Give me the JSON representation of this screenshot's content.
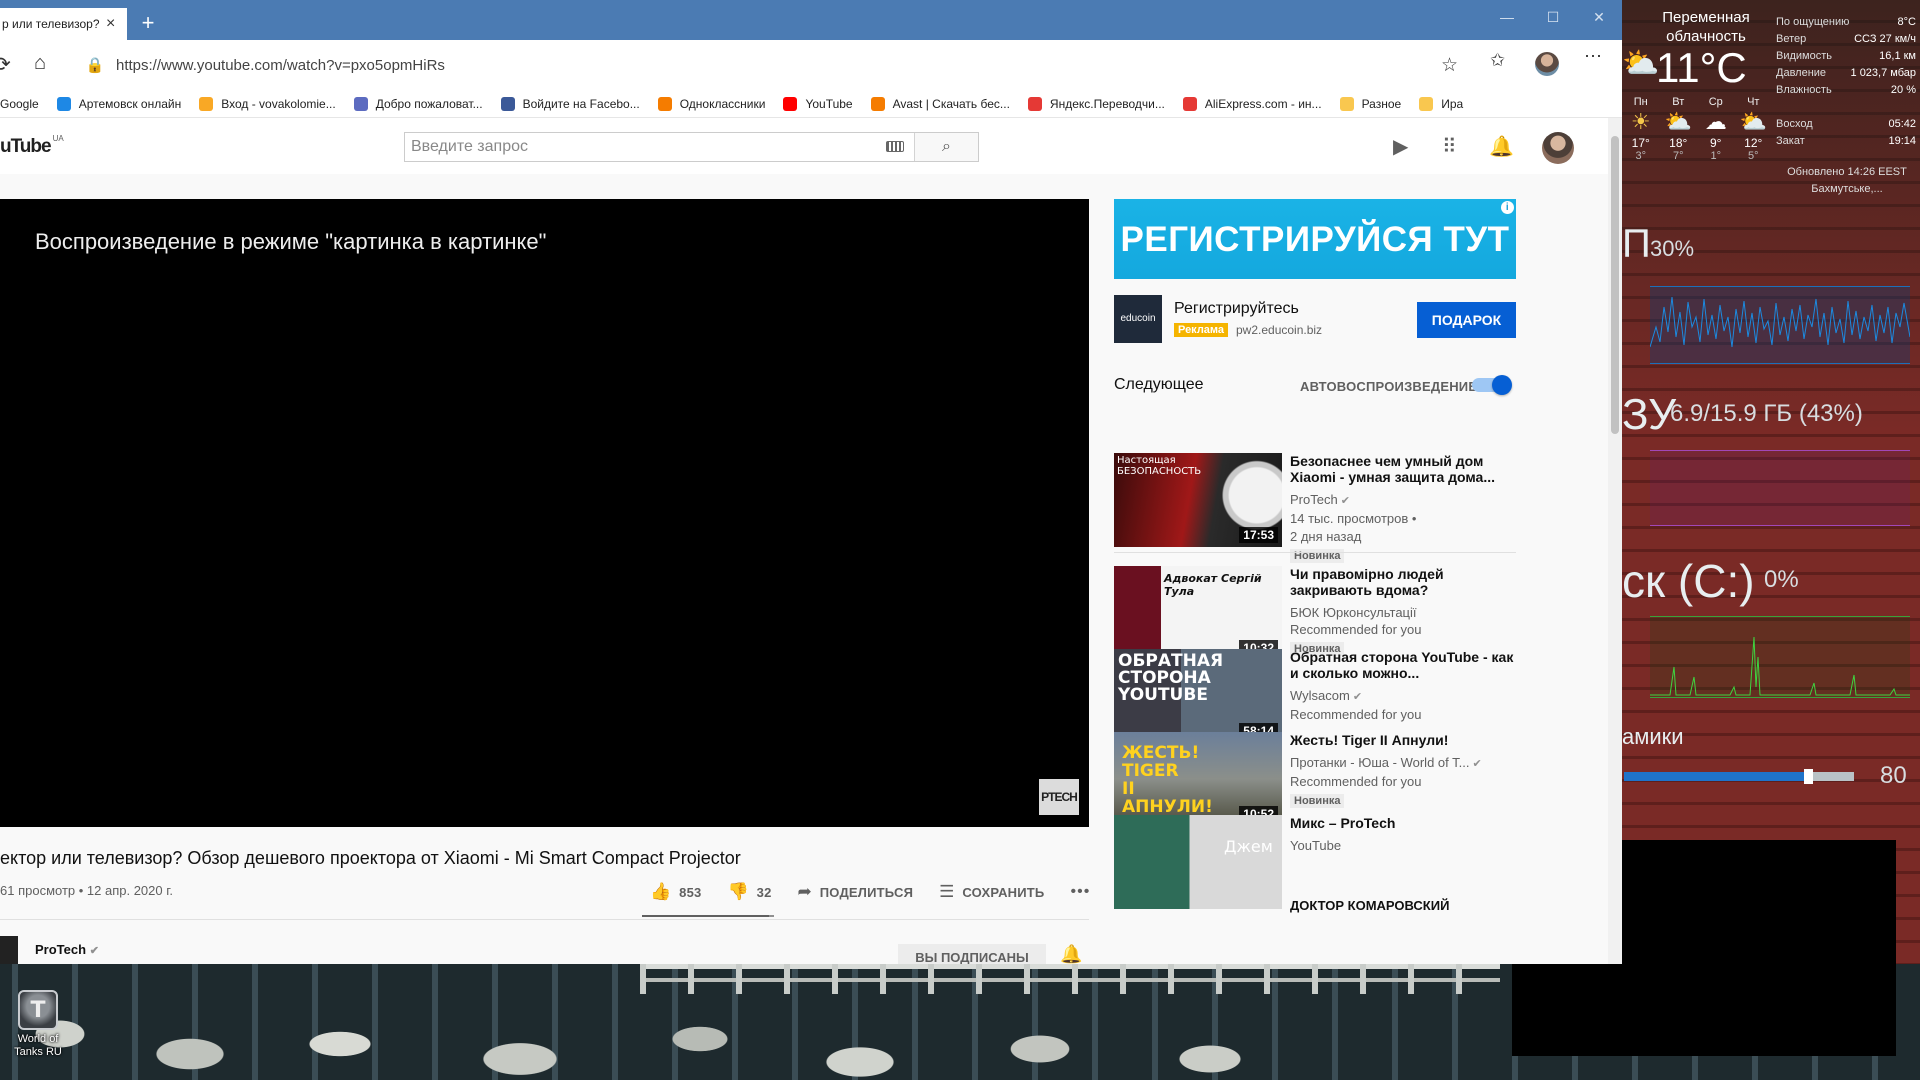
{
  "browser": {
    "tab_title": "р или телевизор?",
    "tab_close": "×",
    "new_tab": "+",
    "url": "https://www.youtube.com/watch?v=pxo5opmHiRs",
    "window_controls": [
      "—",
      "☐",
      "✕"
    ]
  },
  "bookmarks": [
    {
      "label": "Google",
      "icon_color": "#ffffff"
    },
    {
      "label": "Артемовск онлайн",
      "icon_color": "#1e88e5"
    },
    {
      "label": "Вход - vovakolomie...",
      "icon_color": "#f9a825"
    },
    {
      "label": "Добро пожаловат...",
      "icon_color": "#5c6bc0"
    },
    {
      "label": "Войдите на Facebo...",
      "icon_color": "#3b5998"
    },
    {
      "label": "Одноклассники",
      "icon_color": "#f57c00"
    },
    {
      "label": "YouTube",
      "icon_color": "#ff0000"
    },
    {
      "label": "Avast | Скачать бес...",
      "icon_color": "#f57c00"
    },
    {
      "label": "Яндекс.Переводчи...",
      "icon_color": "#e53935"
    },
    {
      "label": "AliExpress.com - ин...",
      "icon_color": "#e53935"
    },
    {
      "label": "Разное",
      "icon_color": "#f9c74f"
    },
    {
      "label": "Ира",
      "icon_color": "#f9c74f"
    }
  ],
  "youtube": {
    "logo": "uTube",
    "logo_region": "UA",
    "search_placeholder": "Введите запрос",
    "pip_message": "Воспроизведение в режиме \"картинка в картинке\"",
    "watermark": "PTECH",
    "video_title": "ектор или телевизор? Обзор дешевого проектора от Xiaomi - Mi Smart Compact Projector",
    "video_meta": "61 просмотр • 12 апр. 2020 г.",
    "likes": "853",
    "dislikes": "32",
    "like_ratio": 0.96,
    "share_label": "ПОДЕЛИТЬСЯ",
    "save_label": "СОХРАНИТЬ",
    "more_label": "•••",
    "channel_name": "ProTech",
    "subscribed_label": "ВЫ ПОДПИСАНЫ"
  },
  "ad": {
    "banner_text": "РЕГИСТРИРУЙСЯ ТУТ",
    "logo_text": "educoin",
    "name": "Регистрируйтесь",
    "badge": "Реклама",
    "domain": "pw2.educoin.biz",
    "cta": "ПОДАРОК"
  },
  "up_next": {
    "header": "Следующее",
    "autoplay_label": "АВТОВОСПРОИЗВЕДЕНИЕ",
    "autoplay_on": true,
    "videos": [
      {
        "title": "Безопаснее чем умный дом Xiaomi - умная защита дома...",
        "channel": "ProTech",
        "verified": true,
        "views": "14 тыс. просмотров •",
        "age": "2 дня назад",
        "badge": "Новинка",
        "duration": "17:53",
        "thumb_text": "Настоящая БЕЗОПАСНОСТЬ"
      },
      {
        "title": "Чи правомірно людей закривають вдома?",
        "channel": "БЮК Юрконсультації",
        "verified": false,
        "views": "Recommended for you",
        "age": "",
        "badge": "Новинка",
        "duration": "10:32",
        "thumb_text": "Адвокат Сергій Тула"
      },
      {
        "title": "Обратная сторона YouTube - как и сколько можно...",
        "channel": "Wylsacom",
        "verified": true,
        "views": "Recommended for you",
        "age": "",
        "badge": "",
        "duration": "58:14",
        "thumb_text": "ОБРАТНАЯ СТОРОНА YOUTUBE"
      },
      {
        "title": "Жесть! Tiger II Апнули!",
        "channel": "Протанки - Юша - World of T...",
        "verified": true,
        "views": "Recommended for you",
        "age": "",
        "badge": "Новинка",
        "duration": "10:52",
        "thumb_text": "ЖЕСТЬ! TIGER II АПНУЛИ!"
      },
      {
        "title": "Микс – ProTech",
        "channel": "YouTube",
        "verified": false,
        "views": "",
        "age": "",
        "badge": "",
        "duration": "",
        "thumb_text": "Джем"
      }
    ],
    "partial_next_title": "ДОКТОР КОМАРОВСКИЙ"
  },
  "weather": {
    "condition": "Переменная облачность",
    "temp": "11°C",
    "details": [
      {
        "k": "По ощущению",
        "v": "8°C"
      },
      {
        "k": "Ветер",
        "v": "ССЗ 27 км/ч"
      },
      {
        "k": "Видимость",
        "v": "16,1 км"
      },
      {
        "k": "Давление",
        "v": "1 023,7 мбар"
      },
      {
        "k": "Влажность",
        "v": "20 %"
      }
    ],
    "forecast": [
      {
        "day": "Пн",
        "hi": "17°",
        "lo": "3°",
        "icon": "sun"
      },
      {
        "day": "Вт",
        "hi": "18°",
        "lo": "7°",
        "icon": "partly-cloudy"
      },
      {
        "day": "Ср",
        "hi": "9°",
        "lo": "1°",
        "icon": "rain-cloud"
      },
      {
        "day": "Чт",
        "hi": "12°",
        "lo": "5°",
        "icon": "partly-cloudy"
      }
    ],
    "sunrise_label": "Восход",
    "sunrise": "05:42",
    "sunset_label": "Закат",
    "sunset": "19:14",
    "updated": "Обновлено 14:26 EEST",
    "location": "Бахмутське,..."
  },
  "system": {
    "cpu_title": "П",
    "cpu_value": "30%",
    "ram_title": "ЗУ",
    "ram_value": "6.9/15.9 ГБ (43%)",
    "disk_title": "ск (C:)",
    "disk_value": "0%",
    "volume_title": "амики",
    "volume_value": "80",
    "volume_level": 0.8
  },
  "desktop_icon": {
    "label": "World of Tanks RU"
  },
  "colors": {
    "youtube_blue": "#065fd4",
    "titlebar": "#4b7bb3",
    "ad_banner": "#1ab3e6",
    "cpu_graph": "#1c6fb9",
    "ram_graph": "#a247b8",
    "disk_graph": "#3aa23a"
  }
}
